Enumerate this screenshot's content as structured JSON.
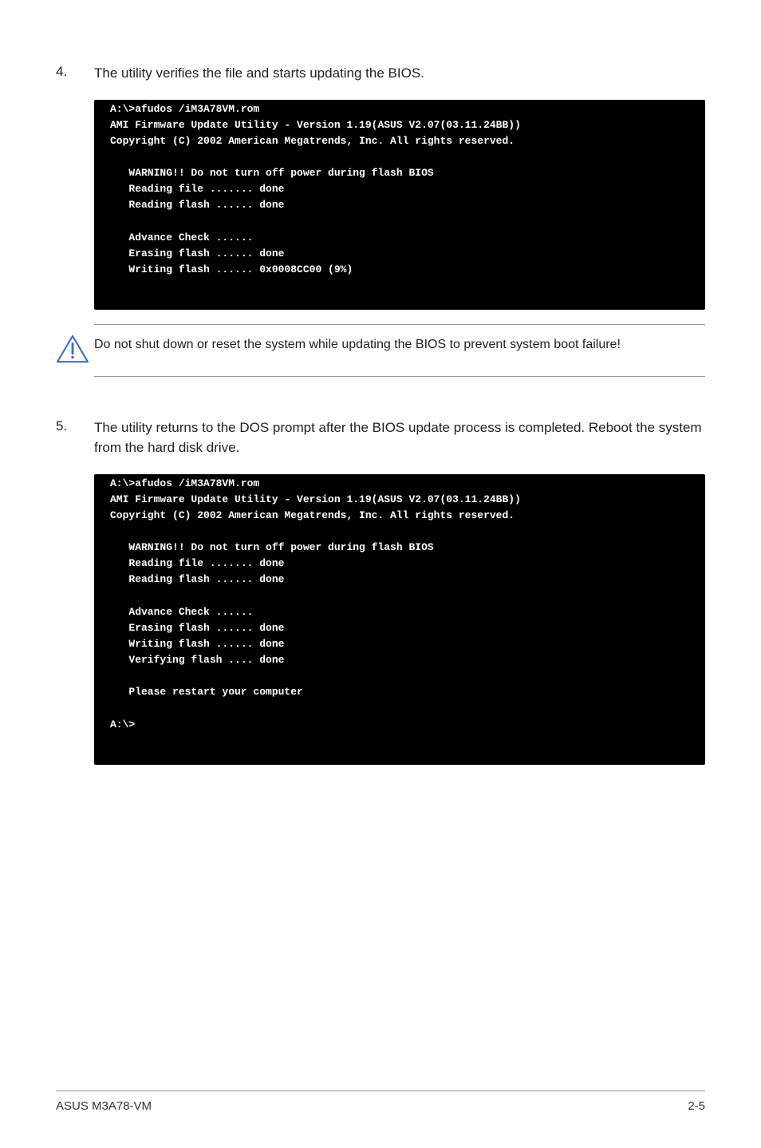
{
  "step4": {
    "num": "4.",
    "text": "The utility verifies the file and starts updating the BIOS."
  },
  "terminal1": {
    "l01": "A:\\>afudos /iM3A78VM.rom",
    "l02": "AMI Firmware Update Utility - Version 1.19(ASUS V2.07(03.11.24BB))",
    "l03": "Copyright (C) 2002 American Megatrends, Inc. All rights reserved.",
    "l04": "",
    "l05": "   WARNING!! Do not turn off power during flash BIOS",
    "l06": "   Reading file ....... done",
    "l07": "   Reading flash ...... done",
    "l08": "",
    "l09": "   Advance Check ......",
    "l10": "   Erasing flash ...... done",
    "l11": "   Writing flash ...... 0x0008CC00 (9%)",
    "l12": "",
    "l13": ""
  },
  "callout": {
    "text": "Do not shut down or reset the system while updating the BIOS to prevent system boot failure!"
  },
  "step5": {
    "num": "5.",
    "text": "The utility returns to the DOS prompt after the BIOS update process is completed. Reboot the system from the hard disk drive."
  },
  "terminal2": {
    "l01": "A:\\>afudos /iM3A78VM.rom",
    "l02": "AMI Firmware Update Utility - Version 1.19(ASUS V2.07(03.11.24BB))",
    "l03": "Copyright (C) 2002 American Megatrends, Inc. All rights reserved.",
    "l04": "",
    "l05": "   WARNING!! Do not turn off power during flash BIOS",
    "l06": "   Reading file ....... done",
    "l07": "   Reading flash ...... done",
    "l08": "",
    "l09": "   Advance Check ......",
    "l10": "   Erasing flash ...... done",
    "l11": "   Writing flash ...... done",
    "l12": "   Verifying flash .... done",
    "l13": "",
    "l14": "   Please restart your computer",
    "l15": "",
    "l16": "A:\\>",
    "l17": "",
    "l18": ""
  },
  "footer": {
    "left": "ASUS M3A78-VM",
    "right": "2-5"
  }
}
